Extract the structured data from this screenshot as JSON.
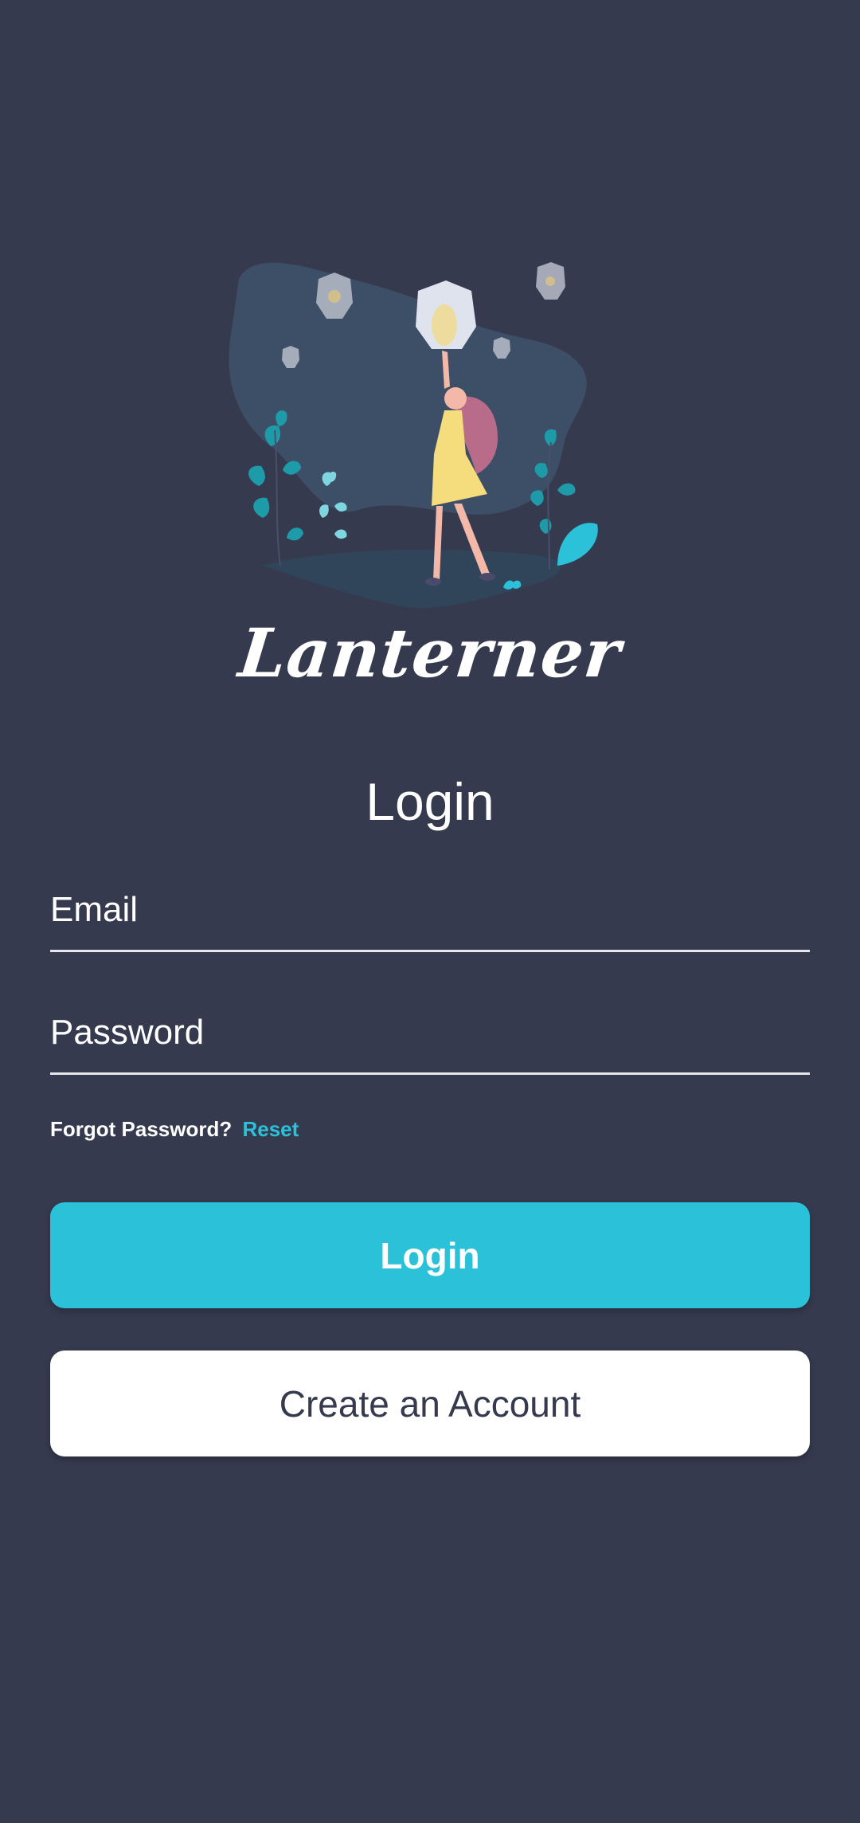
{
  "app": {
    "brand_name": "Lanterner",
    "illustration": "girl-releasing-lantern-illustration"
  },
  "login": {
    "title": "Login",
    "email_placeholder": "Email",
    "password_placeholder": "Password",
    "forgot_text": "Forgot Password?",
    "reset_link": "Reset",
    "login_button": "Login",
    "create_account_button": "Create an Account"
  },
  "colors": {
    "background": "#363a4f",
    "accent": "#2bc1d8",
    "text": "#ffffff"
  }
}
